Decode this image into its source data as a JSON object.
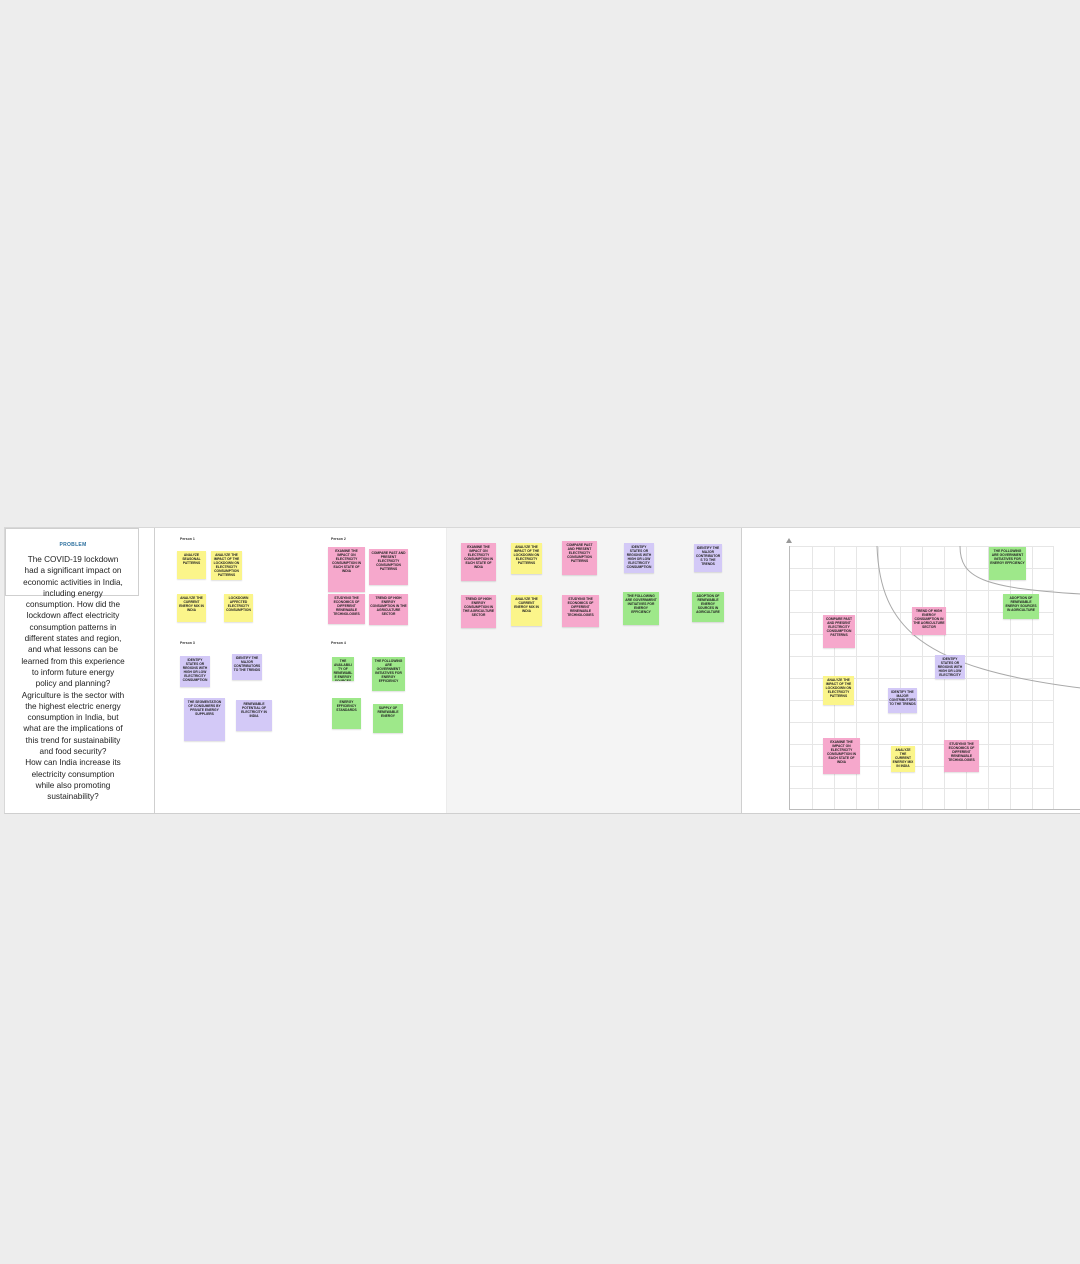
{
  "problem": {
    "heading": "PROBLEM",
    "text": "The COVID-19 lockdown\nhad a significant impact on\neconomic activities in India,\nincluding energy\nconsumption. How did the\nlockdown affect electricity\nconsumption patterns in\ndifferent states and region,\nand what lessons can be\nlearned from this experience\nto inform future energy\npolicy and planning?\nAgriculture is the sector with\nthe highest electric energy\nconsumption in India, but\nwhat are the implications of\nthis trend for sustainability\nand food security?\nHow can India increase its\nelectricity consumption\nwhile also promoting\nsustainability?"
  },
  "brainstorm": {
    "persons": [
      "Person 1",
      "Person 2",
      "Person 3",
      "Person 4"
    ],
    "notes": [
      {
        "text": "ANALYZE SEASONAL PATTERNS",
        "color": "yellow"
      },
      {
        "text": "ANALYZE THE IMPACT OF THE LOCKDOWN ON ELECTRICITY CONSUMPTION PATTERNS",
        "color": "yellow"
      },
      {
        "text": "ANALYZE THE CURRENT ENERGY MIX IN INDIA",
        "color": "yellow"
      },
      {
        "text": "LOCKDOWN AFFECTED ELECTRICITY CONSUMPTION",
        "color": "yellow"
      },
      {
        "text": "EXAMINE THE IMPACT ON ELECTRICITY CONSUMPTION IN EACH STATE OF INDIA",
        "color": "pink"
      },
      {
        "text": "COMPARE PAST AND PRESENT ELECTRICITY CONSUMPTION PATTERNS",
        "color": "pink"
      },
      {
        "text": "STUDYING THE ECONOMICS OF DIFFERENT RENEWABLE TECHNOLOGIES",
        "color": "pink"
      },
      {
        "text": "TREND OF HIGH ENERGY CONSUMPTION IN THE AGRICULTURE SECTOR",
        "color": "pink"
      },
      {
        "text": "IDENTIFY STATES OR REGIONS WITH HIGH OR LOW ELECTRICITY CONSUMPTION",
        "color": "purple"
      },
      {
        "text": "IDENTIFY THE MAJOR CONTRIBUTORS TO THE TRENDS",
        "color": "purple"
      },
      {
        "text": "THE SEGMENTATION OF CONSUMERS BY PRIVATE ENERGY SUPPLIERS",
        "color": "purple"
      },
      {
        "text": "RENEWABLE POTENTIAL OF ELECTRICITY IN INDIA",
        "color": "purple"
      },
      {
        "text": "THE AVAILABILITY OF RENEWABLE ENERGY SOURCES",
        "color": "green"
      },
      {
        "text": "THE FOLLOWING ARE GOVERNMENT INITIATIVES FOR ENERGY EFFICIENCY",
        "color": "green"
      },
      {
        "text": "ENERGY EFFICIENCY STANDARDS",
        "color": "green"
      },
      {
        "text": "SUPPLY OF RENEWABLE ENERGY",
        "color": "green"
      }
    ]
  },
  "groups": {
    "notes": [
      {
        "text": "EXAMINE THE IMPACT ON ELECTRICITY CONSUMPTION IN EACH STATE OF INDIA",
        "color": "pink"
      },
      {
        "text": "ANALYZE THE IMPACT OF THE LOCKDOWN ON ELECTRICITY PATTERNS",
        "color": "yellow"
      },
      {
        "text": "COMPARE PAST AND PRESENT ELECTRICITY CONSUMPTION PATTERNS",
        "color": "pink"
      },
      {
        "text": "IDENTIFY STATES OR REGIONS WITH HIGH OR LOW ELECTRICITY CONSUMPTION",
        "color": "purple"
      },
      {
        "text": "IDENTIFY THE MAJOR CONTRIBUTORS TO THE TRENDS",
        "color": "purple"
      },
      {
        "text": "TREND OF HIGH ENERGY CONSUMPTION IN THE AGRICULTURE SECTOR",
        "color": "pink"
      },
      {
        "text": "ANALYZE THE CURRENT ENERGY MIX IN INDIA",
        "color": "yellow"
      },
      {
        "text": "STUDYING THE ECONOMICS OF DIFFERENT RENEWABLE TECHNOLOGIES",
        "color": "pink"
      },
      {
        "text": "THE FOLLOWING ARE GOVERNMENT INITIATIVES FOR ENERGY EFFICIENCY",
        "color": "green"
      },
      {
        "text": "ADOPTION OF RENEWABLE ENERGY SOURCES IN AGRICULTURE",
        "color": "green"
      }
    ]
  },
  "matrix": {
    "notes": [
      {
        "text": "THE FOLLOWING ARE GOVERNMENT INITIATIVES FOR ENERGY EFFICIENCY",
        "color": "green"
      },
      {
        "text": "ADOPTION OF RENEWABLE ENERGY SOURCES IN AGRICULTURE",
        "color": "green"
      },
      {
        "text": "TREND OF HIGH ENERGY CONSUMPTION IN THE AGRICULTURE SECTOR",
        "color": "pink"
      },
      {
        "text": "COMPARE PAST AND PRESENT ELECTRICITY CONSUMPTION PATTERNS",
        "color": "pink"
      },
      {
        "text": "IDENTIFY STATES OR REGIONS WITH HIGH OR LOW ELECTRICITY",
        "color": "purple"
      },
      {
        "text": "ANALYZE THE IMPACT OF THE LOCKDOWN ON ELECTRICITY PATTERNS",
        "color": "yellow"
      },
      {
        "text": "IDENTIFY THE MAJOR CONTRIBUTORS TO THE TRENDS",
        "color": "purple"
      },
      {
        "text": "EXAMINE THE IMPACT ON ELECTRICITY CONSUMPTION IN EACH STATE OF INDIA",
        "color": "pink"
      },
      {
        "text": "ANALYZE THE CURRENT ENERGY MIX IN INDIA",
        "color": "yellow"
      },
      {
        "text": "STUDYING THE ECONOMICS OF DIFFERENT RENEWABLE TECHNOLOGIES",
        "color": "pink"
      }
    ]
  },
  "colors": {
    "yellow": "#fbf58a",
    "pink": "#f6a8cc",
    "purple": "#d3c9f7",
    "green": "#9ee88a",
    "accent": "#2b6f9e"
  }
}
